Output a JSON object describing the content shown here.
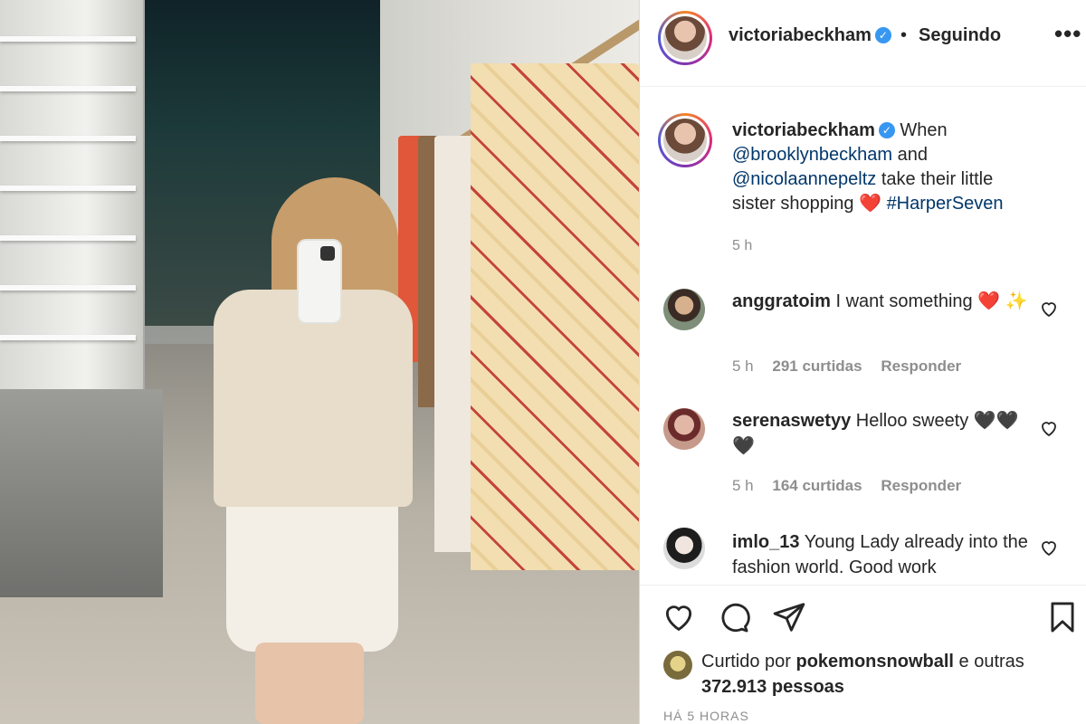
{
  "post": {
    "author": "victoriabeckham",
    "follow_status": "Seguindo",
    "more_label": "•••",
    "caption": {
      "username": "victoriabeckham",
      "text_before": "When",
      "mention_1": "@brooklynbeckham",
      "and_text": "and",
      "mention_2": "@nicolaannepeltz",
      "text_after": "take their little sister shopping",
      "emoji": "❤️",
      "hashtag": "#HarperSeven",
      "time": "5 h"
    },
    "comments": [
      {
        "username": "anggratoim",
        "text": "I want something",
        "emoji": "❤️ ✨",
        "time": "5 h",
        "likes": "291 curtidas",
        "reply": "Responder"
      },
      {
        "username": "serenaswetyy",
        "text": "Helloo sweety",
        "emoji": "🖤🖤 🖤",
        "time": "5 h",
        "likes": "164 curtidas",
        "reply": "Responder"
      },
      {
        "username": "imlo_13",
        "text": "Young Lady already into the fashion world. Good work",
        "emoji": "",
        "time": "",
        "likes": "",
        "reply": ""
      }
    ],
    "liked_by": {
      "prefix": "Curtido por",
      "user": "pokemonsnowball",
      "suffix": "e outras",
      "count": "372.913",
      "people": "pessoas"
    },
    "posted_ago": "HÁ 5 HORAS"
  },
  "icons": [
    "verified-badge-icon",
    "heart-icon",
    "comment-icon",
    "share-icon",
    "bookmark-icon",
    "more-icon"
  ],
  "colors": {
    "link": "#00376b",
    "verified": "#3897f0",
    "muted": "#8e8e8e",
    "heart": "#e02f3d"
  }
}
